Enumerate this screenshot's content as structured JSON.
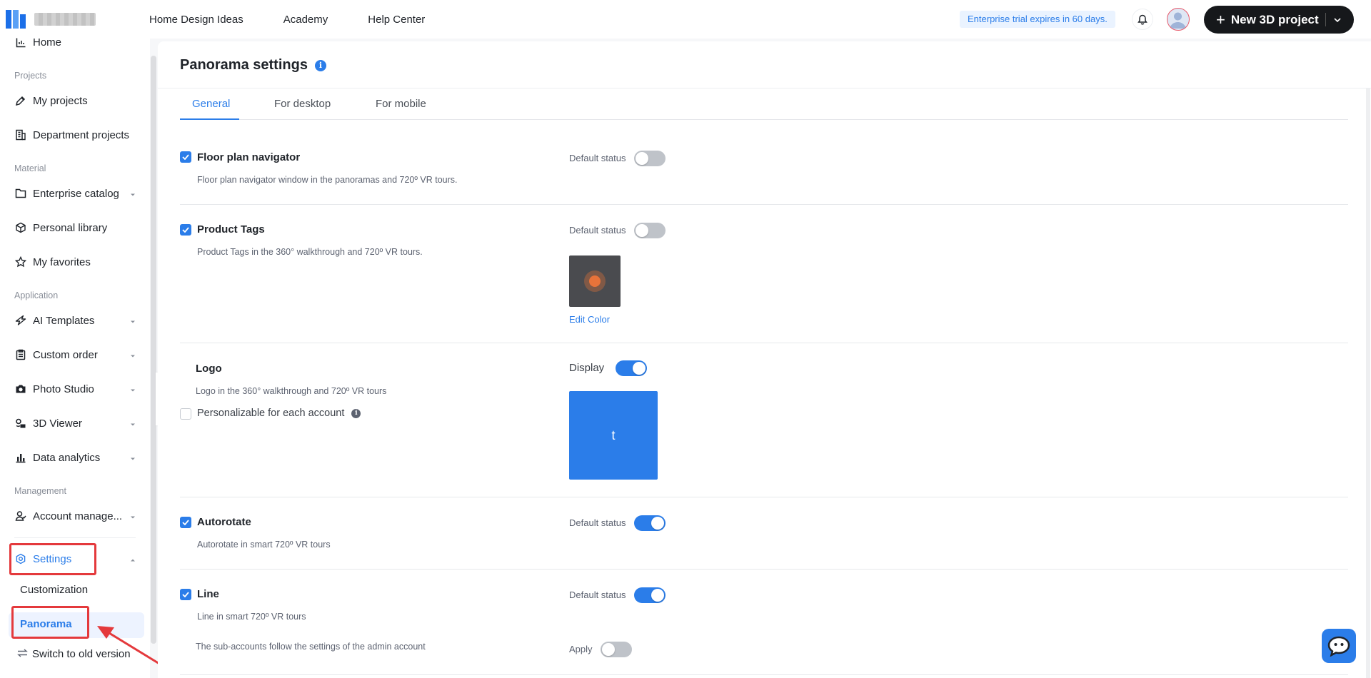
{
  "topbar": {
    "nav": [
      "Home Design Ideas",
      "Academy",
      "Help Center"
    ],
    "trial_text": "Enterprise trial expires in 60 days.",
    "new_project_label": "New 3D project"
  },
  "sidebar": {
    "home": "Home",
    "section_projects": "Projects",
    "my_projects": "My projects",
    "department_projects": "Department projects",
    "section_material": "Material",
    "enterprise_catalog": "Enterprise catalog",
    "personal_library": "Personal library",
    "my_favorites": "My favorites",
    "section_application": "Application",
    "ai_templates": "AI Templates",
    "custom_order": "Custom order",
    "photo_studio": "Photo Studio",
    "viewer_3d": "3D Viewer",
    "data_analytics": "Data analytics",
    "section_management": "Management",
    "account_management": "Account manage...",
    "settings": "Settings",
    "customization": "Customization",
    "panorama": "Panorama",
    "switch_old": "Switch to old version"
  },
  "page": {
    "title": "Panorama settings",
    "tabs": [
      "General",
      "For desktop",
      "For mobile"
    ],
    "active_tab": "General"
  },
  "settings": {
    "floor_plan": {
      "title": "Floor plan navigator",
      "desc": "Floor plan navigator window in the panoramas and 720º VR tours.",
      "status_label": "Default status",
      "checked": true,
      "on": false
    },
    "product_tags": {
      "title": "Product Tags",
      "desc": "Product Tags in the 360° walkthrough and 720º VR tours.",
      "status_label": "Default status",
      "checked": true,
      "on": false,
      "edit_color": "Edit Color",
      "tag_color": "#e8733a"
    },
    "logo": {
      "title": "Logo",
      "desc": "Logo in the 360° walkthrough and 720º VR tours",
      "display_label": "Display",
      "on": true,
      "personalizable": "Personalizable for each account",
      "personalizable_checked": false,
      "logo_text": "t"
    },
    "autorotate": {
      "title": "Autorotate",
      "desc": "Autorotate in smart 720º VR tours",
      "status_label": "Default status",
      "checked": true,
      "on": true
    },
    "line": {
      "title": "Line",
      "desc": "Line in smart 720º VR tours",
      "status_label": "Default status",
      "checked": true,
      "on": true,
      "sub_accounts": "The sub-accounts follow the settings of the admin account",
      "apply_label": "Apply",
      "apply_on": false
    }
  },
  "colors": {
    "accent": "#2b7de9",
    "highlight_red": "#e4393c",
    "dark_button": "#16181b"
  }
}
